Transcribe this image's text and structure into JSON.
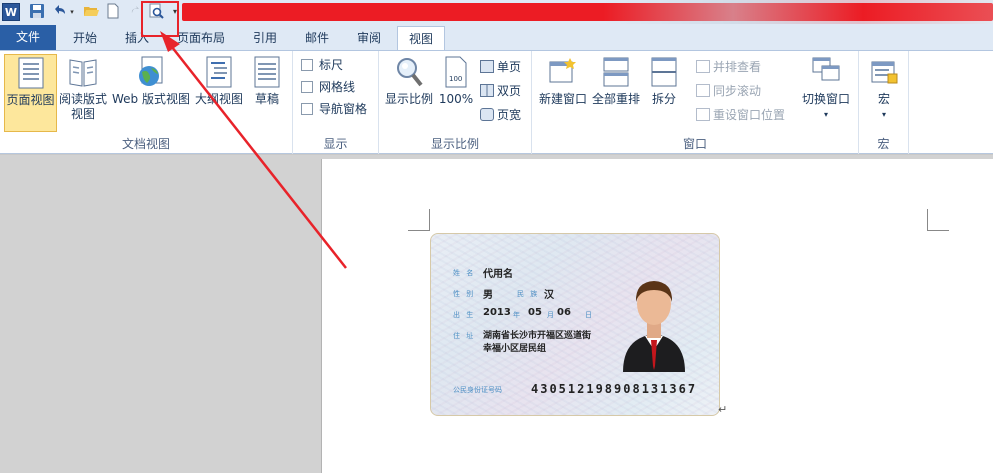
{
  "qat": {
    "app_icon": "W",
    "icons": [
      "word-app-icon",
      "save-icon",
      "undo-icon",
      "open-folder-icon",
      "new-document-icon",
      "redo-icon",
      "print-preview-icon",
      "customize-qat-icon"
    ]
  },
  "tabs": [
    {
      "label": "文件"
    },
    {
      "label": "开始"
    },
    {
      "label": "插入"
    },
    {
      "label": "页面布局"
    },
    {
      "label": "引用"
    },
    {
      "label": "邮件"
    },
    {
      "label": "审阅"
    },
    {
      "label": "视图"
    }
  ],
  "ribbon": {
    "doc_views": {
      "label": "文档视图",
      "print_layout": "页面视图",
      "reading_line1": "阅读版式",
      "reading_line2": "视图",
      "web_layout": "Web 版式视图",
      "outline": "大纲视图",
      "draft": "草稿"
    },
    "show": {
      "label": "显示",
      "ruler": "标尺",
      "gridlines": "网格线",
      "nav_pane": "导航窗格"
    },
    "zoom": {
      "label": "显示比例",
      "zoom": "显示比例",
      "hundred": "100%",
      "one_page": "单页",
      "two_pages": "双页",
      "page_width": "页宽"
    },
    "window": {
      "label": "窗口",
      "new_window": "新建窗口",
      "arrange_all": "全部重排",
      "split": "拆分",
      "side_by_side": "并排查看",
      "sync_scroll": "同步滚动",
      "reset_position": "重设窗口位置",
      "switch_windows": "切换窗口"
    },
    "macros": {
      "label": "宏",
      "macros": "宏"
    }
  },
  "idcard": {
    "name_label": "姓 名",
    "name": "代用名",
    "sex_label": "性 别",
    "sex": "男",
    "ethnicity_label": "民 族",
    "ethnicity": "汉",
    "birth_label": "出 生",
    "birth_year": "2013",
    "year_unit": "年",
    "birth_month": "05",
    "month_unit": "月",
    "birth_day": "06",
    "day_unit": "日",
    "address_label": "住 址",
    "address_line1": "湖南省长沙市开福区巡道街",
    "address_line2": "幸福小区居民组",
    "id_label": "公民身份证号码",
    "id_number": "430512198908131367"
  },
  "colors": {
    "file_tab": "#2a5fa6",
    "annotation_red": "#e8232a",
    "active_button": "#fde79c"
  }
}
